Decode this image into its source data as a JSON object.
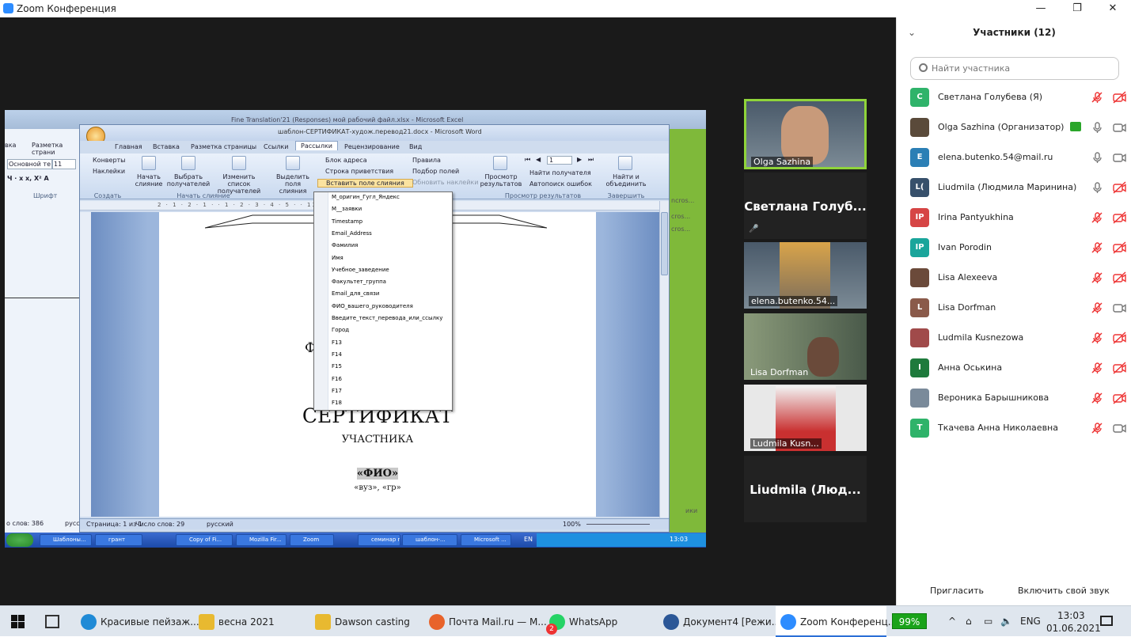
{
  "window": {
    "title": "Zoom Конференция",
    "minimize": "—",
    "maximize": "❐",
    "close": "✕"
  },
  "shared_screen": {
    "excel_title": "Fine Translation'21 (Responses) мой рабочий файл.xlsx - Microsoft Excel",
    "word_title": "шаблон-СЕРТИФИКАТ-худож.перевод21.docx - Microsoft Word",
    "ribbon_tabs": [
      "Главная",
      "Вставка",
      "Разметка страницы",
      "Ссылки",
      "Рассылки",
      "Рецензирование",
      "Вид"
    ],
    "left_app": {
      "tab": "Разметка страни",
      "font": "Основной те",
      "size": "11",
      "bold_row": "Ч ·  x  x, Х² А",
      "group_font": "Шрифт",
      "tab2": "вка"
    },
    "ribbon": {
      "envelopes": "Конверты",
      "labels": "Наклейки",
      "group_create": "Создать",
      "start_merge": "Начать слияние",
      "select_recipients": "Выбрать получателей",
      "edit_list": "Изменить список получателей",
      "group_start": "Начать слияние",
      "highlight": "Выделить поля слияния",
      "address_block": "Блок адреса",
      "greeting_line": "Строка приветствия",
      "insert_field": "Вставить поле слияния",
      "rules": "Правила",
      "match_fields": "Подбор полей",
      "update_labels": "Обновить наклейки",
      "preview": "Просмотр результатов",
      "record": "1",
      "find_recipient": "Найти получателя",
      "auto_check": "Автопоиск ошибок",
      "group_preview": "Просмотр результатов",
      "finish": "Найти и объединить",
      "group_finish": "Завершить"
    },
    "ruler": "2 · 1 · 2 · 1 · · 1 · 2 · 3 · 4 · 5 · · 13 · 14 · 15 · 16 · 17 · 18",
    "merge_fields": [
      "М_оригин_Гугл_Яндекс",
      "М__заявки",
      "Timestamp",
      "Email_Address",
      "Фамилия",
      "Имя",
      "Учебное_заведение",
      "Факультет_группа",
      "Email_для_связи",
      "ФИО_вашего_руководителя",
      "Введите_текст_перевода_или_ссылку",
      "Город",
      "F13",
      "F14",
      "F15",
      "F16",
      "F17",
      "F18"
    ],
    "document": {
      "faculty": "ФАКУЛЬТ                     КУССТВ",
      "dept": "Кафед                          ков",
      "certificate": "СЕРТИФИКАТ",
      "participant": "УЧАСТНИКА",
      "fio": "«ФИО»",
      "uni": "«вуз», «гр»"
    },
    "status": {
      "words_left": "о слов: 386",
      "lang_left": "русс",
      "page": "Страница: 1 из 1",
      "words": "Число слов: 29",
      "lang": "русский",
      "zoom": "100%"
    },
    "xp_taskbar": {
      "items": [
        "Шаблоны...",
        "грант",
        "Copy of Fi...",
        "Mozilla Fir...",
        "Zoom",
        "семинар п...",
        "шаблон-...",
        "Microsoft ..."
      ],
      "lang": "EN",
      "time": "13:03"
    },
    "side_text": [
      "ncros...",
      "cros...",
      "cros...",
      "ики"
    ]
  },
  "tiles": [
    {
      "name": "Olga Sazhina",
      "type": "video"
    },
    {
      "name": "Светлана  Голуб...",
      "type": "name"
    },
    {
      "name": "elena.butenko.54...",
      "type": "video"
    },
    {
      "name": "Lisa Dorfman",
      "type": "video"
    },
    {
      "name": "Ludmila Kusn...",
      "type": "video"
    },
    {
      "name": "Liudmila  (Люд...",
      "type": "name"
    }
  ],
  "panel": {
    "title": "Участники (12)",
    "search_placeholder": "Найти участника",
    "participants": [
      {
        "initials": "С",
        "color": "#2fb36a",
        "name": "Светлана Голубева (Я)",
        "mic": "muted",
        "video": "off"
      },
      {
        "initials": "",
        "color": "#5a4a3a",
        "name": "Olga Sazhina (Организатор)",
        "mic": "on",
        "video": "on",
        "sharing": true
      },
      {
        "initials": "E",
        "color": "#2b7fb5",
        "name": "elena.butenko.54@mail.ru",
        "mic": "on",
        "video": "on"
      },
      {
        "initials": "L(",
        "color": "#37506b",
        "name": "Liudmila (Людмила Маринина)",
        "mic": "on",
        "video": "off"
      },
      {
        "initials": "IP",
        "color": "#d64545",
        "name": "Irina Pantyukhina",
        "mic": "muted",
        "video": "off"
      },
      {
        "initials": "IP",
        "color": "#1aa59b",
        "name": "Ivan Porodin",
        "mic": "muted",
        "video": "off"
      },
      {
        "initials": "",
        "color": "#6b4a3a",
        "name": "Lisa Alexeeva",
        "mic": "muted",
        "video": "off"
      },
      {
        "initials": "L",
        "color": "#8a5a4a",
        "name": "Lisa Dorfman",
        "mic": "muted",
        "video": "on"
      },
      {
        "initials": "",
        "color": "#a04a4a",
        "name": "Ludmila Kusnezowa",
        "mic": "muted",
        "video": "off"
      },
      {
        "initials": "I",
        "color": "#1e7a3c",
        "name": "Анна Оськина",
        "mic": "muted",
        "video": "off"
      },
      {
        "initials": "",
        "color": "#7a8a9a",
        "name": "Вероника Барышникова",
        "mic": "muted",
        "video": "off"
      },
      {
        "initials": "T",
        "color": "#2fb36a",
        "name": "Ткачева Анна Николаевна",
        "mic": "muted",
        "video": "on"
      }
    ],
    "invite": "Пригласить",
    "unmute": "Включить свой звук"
  },
  "taskbar": {
    "items": [
      {
        "label": "Красивые пейзаж...",
        "icon": "edge-icon",
        "color": "#1f8ad6"
      },
      {
        "label": "весна 2021",
        "icon": "folder-icon",
        "color": "#e8b930"
      },
      {
        "label": "Dawson casting",
        "icon": "folder-icon",
        "color": "#e8b930"
      },
      {
        "label": "Почта Mail.ru — M...",
        "icon": "firefox-icon",
        "color": "#e8632b"
      },
      {
        "label": "WhatsApp",
        "icon": "whatsapp-icon",
        "color": "#25d366"
      },
      {
        "label": "Документ4 [Режи...",
        "icon": "word-icon",
        "color": "#2b5797"
      },
      {
        "label": "Zoom Конференц...",
        "icon": "zoom-icon",
        "color": "#2d8cff"
      }
    ],
    "whatsapp_badge": "2",
    "battery": "99%",
    "lang": "ENG",
    "time": "13:03",
    "date": "01.06.2021"
  }
}
